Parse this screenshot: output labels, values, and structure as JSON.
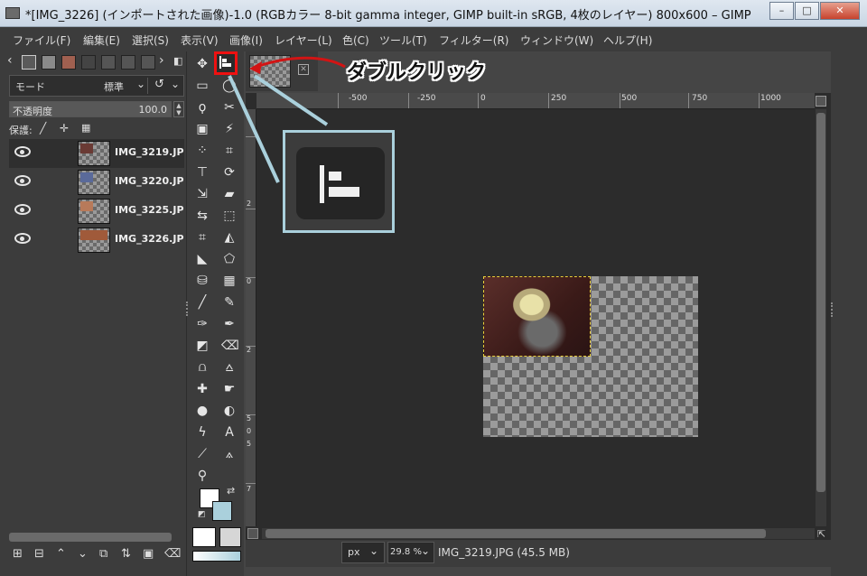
{
  "window": {
    "title": "*[IMG_3226] (インポートされた画像)-1.0 (RGBカラー 8-bit gamma integer, GIMP built-in sRGB, 4枚のレイヤー) 800x600 – GIMP",
    "minimize": "–",
    "maximize": "□",
    "close": "✕"
  },
  "menu": [
    "ファイル(F)",
    "編集(E)",
    "選択(S)",
    "表示(V)",
    "画像(I)",
    "レイヤー(L)",
    "色(C)",
    "ツール(T)",
    "フィルター(R)",
    "ウィンドウ(W)",
    "ヘルプ(H)"
  ],
  "layers_panel": {
    "mode_label": "モード",
    "mode_value": "標準",
    "opacity_label": "不透明度",
    "opacity_value": "100.0",
    "opacity_fraction": 1.0,
    "lock_label": "保護:",
    "layers": [
      {
        "name": "IMG_3219.JP",
        "selected": true
      },
      {
        "name": "IMG_3220.JP",
        "selected": false
      },
      {
        "name": "IMG_3225.JP",
        "selected": false
      },
      {
        "name": "IMG_3226.JP",
        "selected": false
      }
    ]
  },
  "ruler": {
    "top_labels": [
      "-500",
      "-250",
      "0",
      "250",
      "500",
      "750",
      "1000"
    ],
    "left_labels": [
      "2",
      "0",
      "2",
      "5",
      "0",
      "5",
      "7"
    ]
  },
  "annotation": {
    "text": "ダブルクリック"
  },
  "status": {
    "unit": "px",
    "zoom": "29.8 %",
    "info": "IMG_3219.JPG (45.5 MB)"
  },
  "colors": {
    "background_color": "#aad0dc",
    "highlight_border": "#e11111",
    "callout_border": "#aad0dc"
  }
}
